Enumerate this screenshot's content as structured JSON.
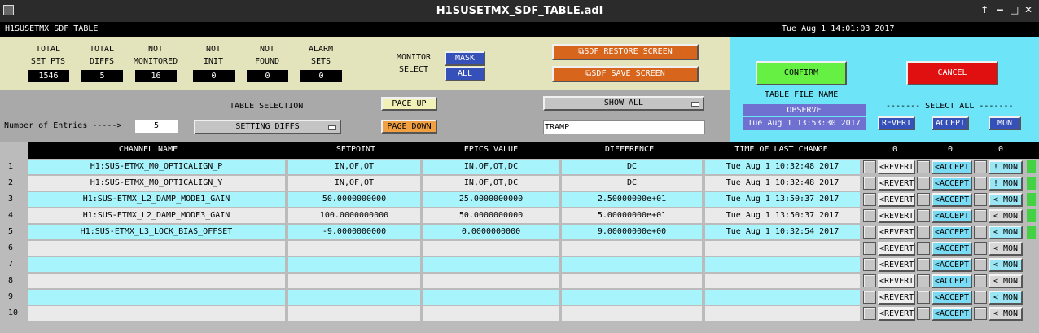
{
  "window": {
    "title": "H1SUSETMX_SDF_TABLE.adl",
    "controls": [
      "↑",
      "−",
      "□",
      "✕"
    ]
  },
  "header": {
    "name": "H1SUSETMX_SDF_TABLE",
    "datetime": "Tue Aug  1 14:01:03 2017"
  },
  "stats": [
    {
      "label1": "TOTAL",
      "label2": "SET PTS",
      "value": "1546"
    },
    {
      "label1": "TOTAL",
      "label2": "DIFFS",
      "value": "5"
    },
    {
      "label1": "NOT",
      "label2": "MONITORED",
      "value": "16"
    },
    {
      "label1": "NOT",
      "label2": "INIT",
      "value": "0"
    },
    {
      "label1": "NOT",
      "label2": "FOUND",
      "value": "0"
    },
    {
      "label1": "ALARM",
      "label2": "SETS",
      "value": "0"
    }
  ],
  "monitor": {
    "label1": "MONITOR",
    "label2": "SELECT",
    "mask": "MASK",
    "all": "ALL"
  },
  "screens": {
    "restore": "⧉SDF RESTORE SCREEN",
    "save": "⧉SDF SAVE SCREEN"
  },
  "table_selection": {
    "entries_label": "Number of Entries ----->",
    "entries_value": "5",
    "title": "TABLE SELECTION",
    "selected": "SETTING DIFFS",
    "page_up": "PAGE UP",
    "page_down": "PAGE DOWN",
    "show": "SHOW ALL",
    "filter": "TRAMP"
  },
  "right": {
    "confirm": "CONFIRM",
    "cancel": "CANCEL",
    "file_label": "TABLE FILE NAME",
    "file_name": "OBSERVE",
    "file_time": "Tue Aug  1 13:53:30 2017",
    "select_all": "------- SELECT ALL -------",
    "revert": "REVERT",
    "accept": "ACCEPT",
    "mon": "MON"
  },
  "columns": {
    "channel": "CHANNEL NAME",
    "setpoint": "SETPOINT",
    "epics": "EPICS VALUE",
    "difference": "DIFFERENCE",
    "time": "TIME OF LAST CHANGE",
    "count_revert": "0",
    "count_accept": "0",
    "count_mon": "0"
  },
  "rows": [
    {
      "num": "1",
      "channel": "H1:SUS-ETMX_M0_OPTICALIGN_P",
      "setpoint": "IN,OF,OT",
      "epics": "IN,OF,OT,DC",
      "difference": "DC",
      "time": "Tue Aug  1 10:32:48 2017",
      "revert": "<REVERT",
      "accept": "<ACCEPT",
      "mon": "! MON"
    },
    {
      "num": "2",
      "channel": "H1:SUS-ETMX_M0_OPTICALIGN_Y",
      "setpoint": "IN,OF,OT",
      "epics": "IN,OF,OT,DC",
      "difference": "DC",
      "time": "Tue Aug  1 10:32:48 2017",
      "revert": "<REVERT",
      "accept": "<ACCEPT",
      "mon": "! MON"
    },
    {
      "num": "3",
      "channel": "H1:SUS-ETMX_L2_DAMP_MODE1_GAIN",
      "setpoint": "50.0000000000",
      "epics": "25.0000000000",
      "difference": "2.50000000e+01",
      "time": "Tue Aug  1 13:50:37 2017",
      "revert": "<REVERT",
      "accept": "<ACCEPT",
      "mon": "< MON"
    },
    {
      "num": "4",
      "channel": "H1:SUS-ETMX_L2_DAMP_MODE3_GAIN",
      "setpoint": "100.0000000000",
      "epics": "50.0000000000",
      "difference": "5.00000000e+01",
      "time": "Tue Aug  1 13:50:37 2017",
      "revert": "<REVERT",
      "accept": "<ACCEPT",
      "mon": "< MON"
    },
    {
      "num": "5",
      "channel": "H1:SUS-ETMX_L3_LOCK_BIAS_OFFSET",
      "setpoint": "-9.0000000000",
      "epics": "0.0000000000",
      "difference": "9.00000000e+00",
      "time": "Tue Aug  1 10:32:54 2017",
      "revert": "<REVERT",
      "accept": "<ACCEPT",
      "mon": "< MON"
    },
    {
      "num": "6",
      "channel": "",
      "setpoint": "",
      "epics": "",
      "difference": "",
      "time": "",
      "revert": "<REVERT",
      "accept": "<ACCEPT",
      "mon": "< MON"
    },
    {
      "num": "7",
      "channel": "",
      "setpoint": "",
      "epics": "",
      "difference": "",
      "time": "",
      "revert": "<REVERT",
      "accept": "<ACCEPT",
      "mon": "< MON"
    },
    {
      "num": "8",
      "channel": "",
      "setpoint": "",
      "epics": "",
      "difference": "",
      "time": "",
      "revert": "<REVERT",
      "accept": "<ACCEPT",
      "mon": "< MON"
    },
    {
      "num": "9",
      "channel": "",
      "setpoint": "",
      "epics": "",
      "difference": "",
      "time": "",
      "revert": "<REVERT",
      "accept": "<ACCEPT",
      "mon": "< MON"
    },
    {
      "num": "10",
      "channel": "",
      "setpoint": "",
      "epics": "",
      "difference": "",
      "time": "",
      "revert": "<REVERT",
      "accept": "<ACCEPT",
      "mon": "< MON"
    }
  ],
  "colors": {
    "row_alt_a": "#a8f4fc",
    "row_alt_b": "#eaeaea",
    "accept": "#7adcf4",
    "confirm": "#66f044",
    "cancel": "#e01010"
  }
}
